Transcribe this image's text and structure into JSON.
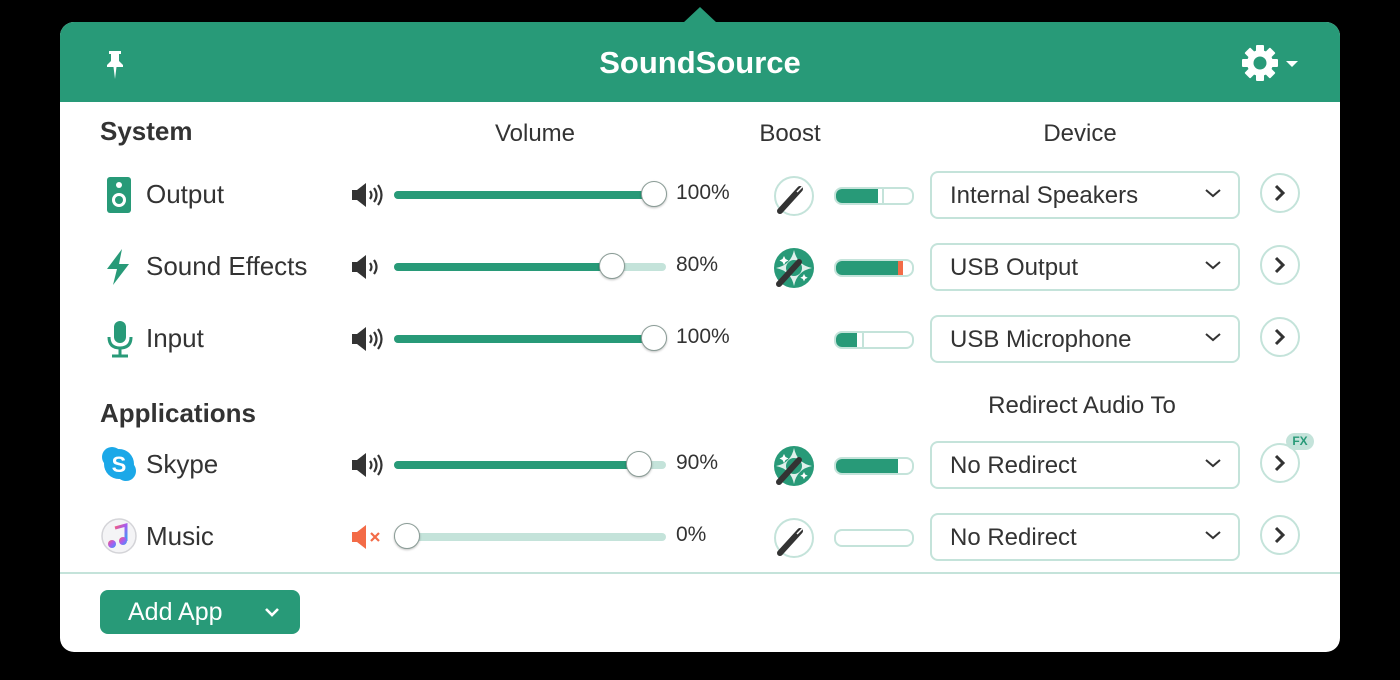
{
  "app": {
    "title": "SoundSource",
    "accent_color": "#289a78",
    "light_accent_color": "#c4e3da",
    "mute_color": "#f36b47"
  },
  "header": {
    "pin_icon": "pin-icon",
    "settings_icon": "gear-icon"
  },
  "columns": {
    "volume": "Volume",
    "boost": "Boost",
    "device": "Device",
    "redirect": "Redirect Audio To"
  },
  "system": {
    "title": "System",
    "rows": [
      {
        "label": "Output",
        "icon": "speaker-box-icon",
        "volume_icon": "speaker-loud-icon",
        "volume": 100,
        "volume_text": "100%",
        "boost": "off",
        "meter_level": 0.55,
        "meter_peak": 0.6,
        "device": "Internal Speakers"
      },
      {
        "label": "Sound Effects",
        "icon": "lightning-icon",
        "volume_icon": "speaker-medium-icon",
        "volume": 80,
        "volume_text": "80%",
        "boost": "on",
        "meter_level": 0.82,
        "meter_peak": 0.82,
        "meter_clipping": true,
        "device": "USB Output"
      },
      {
        "label": "Input",
        "icon": "microphone-icon",
        "volume_icon": "speaker-loud-icon",
        "volume": 100,
        "volume_text": "100%",
        "boost": "none",
        "meter_level": 0.28,
        "meter_peak": 0.34,
        "device": "USB Microphone"
      }
    ]
  },
  "applications": {
    "title": "Applications",
    "rows": [
      {
        "label": "Skype",
        "icon": "skype-icon",
        "volume_icon": "speaker-loud-icon",
        "volume": 90,
        "volume_text": "90%",
        "boost": "on",
        "meter_level": 0.82,
        "device": "No Redirect",
        "fx_badge": "FX"
      },
      {
        "label": "Music",
        "icon": "music-icon",
        "volume_icon": "speaker-muted-icon",
        "volume": 0,
        "volume_text": "0%",
        "boost": "off",
        "meter_level": 0,
        "device": "No Redirect"
      }
    ]
  },
  "footer": {
    "add_app_label": "Add App"
  }
}
